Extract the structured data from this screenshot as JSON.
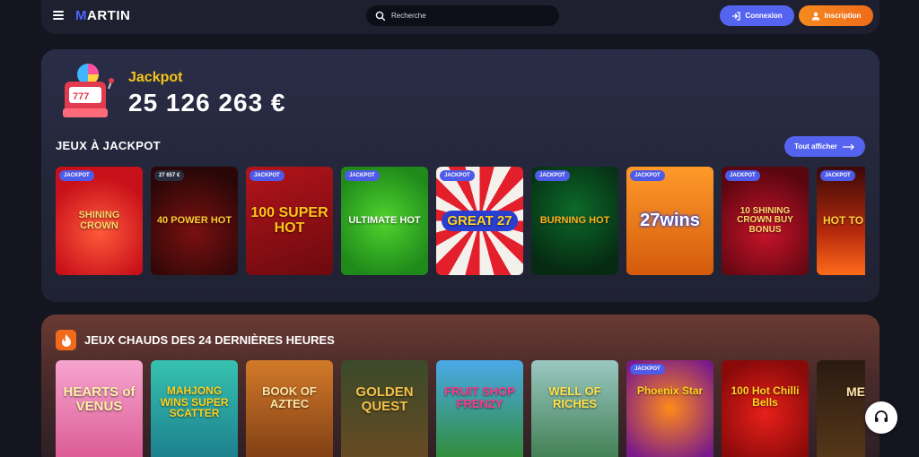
{
  "header": {
    "logo_prefix": "M",
    "logo_rest": "ARTIN",
    "search_placeholder": "Recherche",
    "login_label": "Connexion",
    "signup_label": "Inscription"
  },
  "jackpot": {
    "label": "Jackpot",
    "amount": "25 126 263 €",
    "section_title": "JEUX À JACKPOT",
    "show_all_label": "Tout afficher",
    "games": [
      {
        "title": "SHINING CROWN",
        "badge": "JACKPOT"
      },
      {
        "title": "40 POWER HOT",
        "badge": "27 657 €"
      },
      {
        "title": "100 SUPER HOT",
        "badge": "JACKPOT"
      },
      {
        "title": "ULTIMATE HOT",
        "badge": "JACKPOT"
      },
      {
        "title": "GREAT 27",
        "badge": "JACKPOT"
      },
      {
        "title": "BURNING HOT",
        "badge": "JACKPOT"
      },
      {
        "title": "27wins",
        "badge": "JACKPOT"
      },
      {
        "title": "10 SHINING CROWN BUY BONUS",
        "badge": "JACKPOT"
      },
      {
        "title": "HOT TO BURN",
        "badge": "JACKPOT"
      }
    ]
  },
  "hot": {
    "title": "JEUX CHAUDS DES 24 DERNIÈRES HEURES",
    "games": [
      {
        "title": "HEARTS of VENUS",
        "badge": ""
      },
      {
        "title": "MAHJONG WINS SUPER SCATTER",
        "badge": ""
      },
      {
        "title": "BOOK OF AZTEC",
        "badge": ""
      },
      {
        "title": "GOLDEN QUEST",
        "badge": ""
      },
      {
        "title": "FRUIT SHOP FRENZY",
        "badge": ""
      },
      {
        "title": "WELL OF RICHES",
        "badge": ""
      },
      {
        "title": "Phoenix Star",
        "badge": "JACKPOT"
      },
      {
        "title": "100 Hot Chilli Bells",
        "badge": ""
      },
      {
        "title": "MEN",
        "badge": ""
      }
    ]
  },
  "colors": {
    "accent": "#5564f0",
    "orange": "#f58a1f",
    "gold": "#f5c518"
  }
}
